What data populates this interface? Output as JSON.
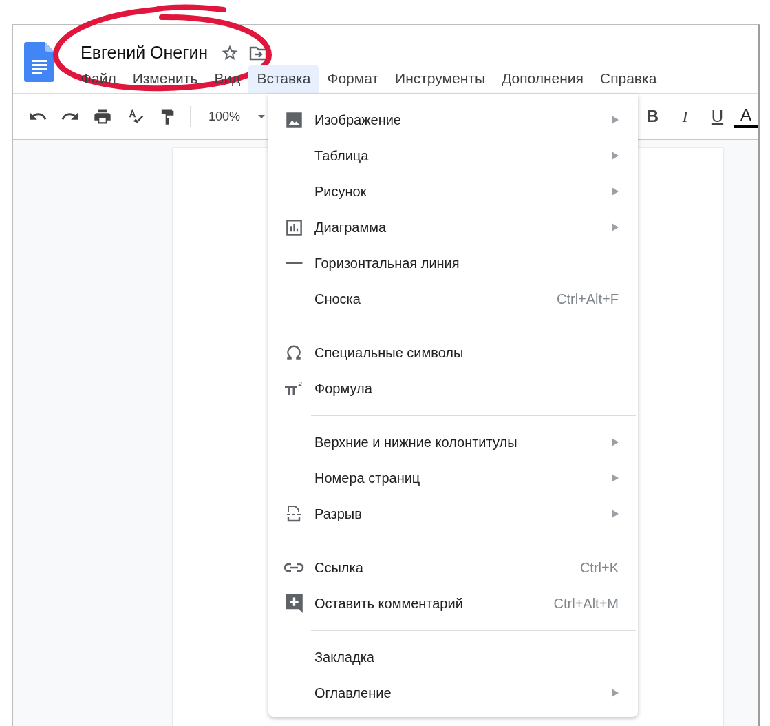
{
  "document": {
    "title": "Евгений Онегин"
  },
  "menu_bar": [
    {
      "label": "Файл",
      "selected": false
    },
    {
      "label": "Изменить",
      "selected": false
    },
    {
      "label": "Вид",
      "selected": false
    },
    {
      "label": "Вставка",
      "selected": true
    },
    {
      "label": "Формат",
      "selected": false
    },
    {
      "label": "Инструменты",
      "selected": false
    },
    {
      "label": "Дополнения",
      "selected": false
    },
    {
      "label": "Справка",
      "selected": false
    }
  ],
  "toolbar": {
    "zoom": "100%",
    "format_buttons": [
      "B",
      "I",
      "U",
      "A"
    ]
  },
  "insert_menu": {
    "sections": [
      [
        {
          "label": "Изображение",
          "kind": "image",
          "submenu": true
        },
        {
          "label": "Таблица",
          "kind": "plain",
          "submenu": true
        },
        {
          "label": "Рисунок",
          "kind": "plain",
          "submenu": true
        },
        {
          "label": "Диаграмма",
          "kind": "chart",
          "submenu": true
        },
        {
          "label": "Горизонтальная линия",
          "kind": "line",
          "submenu": false
        },
        {
          "label": "Сноска",
          "kind": "plain",
          "submenu": false,
          "shortcut": "Ctrl+Alt+F"
        }
      ],
      [
        {
          "label": "Специальные символы",
          "kind": "omega",
          "submenu": false
        },
        {
          "label": "Формула",
          "kind": "pi",
          "submenu": false
        }
      ],
      [
        {
          "label": "Верхние и нижние колонтитулы",
          "kind": "plain",
          "submenu": true
        },
        {
          "label": "Номера страниц",
          "kind": "plain",
          "submenu": true
        },
        {
          "label": "Разрыв",
          "kind": "break",
          "submenu": true
        }
      ],
      [
        {
          "label": "Ссылка",
          "kind": "link",
          "submenu": false,
          "shortcut": "Ctrl+K"
        },
        {
          "label": "Оставить комментарий",
          "kind": "comment",
          "submenu": false,
          "shortcut": "Ctrl+Alt+M"
        }
      ],
      [
        {
          "label": "Закладка",
          "kind": "plain",
          "submenu": false
        },
        {
          "label": "Оглавление",
          "kind": "plain",
          "submenu": true
        }
      ]
    ]
  }
}
